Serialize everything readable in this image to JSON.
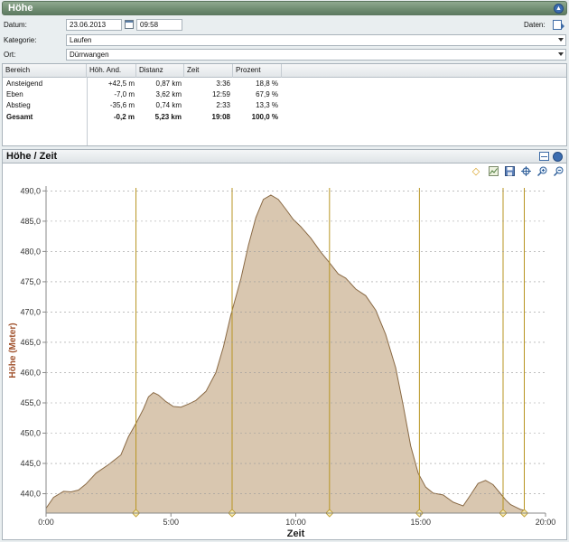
{
  "window": {
    "title": "Höhe"
  },
  "form": {
    "datum_label": "Datum:",
    "datum_value": "23.06.2013",
    "time_value": "09:58",
    "daten_label": "Daten:",
    "kategorie_label": "Kategorie:",
    "kategorie_value": "Laufen",
    "ort_label": "Ort:",
    "ort_value": "Dürrwangen"
  },
  "table": {
    "headers": [
      "Bereich",
      "Höh. And.",
      "Distanz",
      "Zeit",
      "Prozent"
    ],
    "rows": [
      {
        "bereich": "Ansteigend",
        "hoehe": "+42,5 m",
        "distanz": "0,87 km",
        "zeit": "3:36",
        "prozent": "18,8 %"
      },
      {
        "bereich": "Eben",
        "hoehe": "-7,0 m",
        "distanz": "3,62 km",
        "zeit": "12:59",
        "prozent": "67,9 %"
      },
      {
        "bereich": "Abstieg",
        "hoehe": "-35,6 m",
        "distanz": "0,74 km",
        "zeit": "2:33",
        "prozent": "13,3 %"
      },
      {
        "bereich": "Gesamt",
        "hoehe": "-0,2 m",
        "distanz": "5,23 km",
        "zeit": "19:08",
        "prozent": "100,0 %"
      }
    ]
  },
  "chart_panel": {
    "title": "Höhe / Zeit"
  },
  "toolbar_icons": [
    "diamond-marker-icon",
    "chart-settings-icon",
    "save-icon",
    "crosshair-icon",
    "zoom-in-icon",
    "zoom-out-icon"
  ],
  "colors": {
    "fill": "#d9c7b0",
    "stroke": "#8a6a45",
    "marker": "#b89522",
    "axis_label": "#a0522d"
  },
  "chart_data": {
    "type": "area",
    "title": "",
    "xlabel": "Zeit",
    "ylabel": "Höhe (Meter)",
    "xlim": [
      0,
      20
    ],
    "ylim": [
      436.8,
      490.5
    ],
    "x_ticks": [
      "0:00",
      "5:00",
      "10:00",
      "15:00",
      "20:00"
    ],
    "y_ticks": [
      "440,0",
      "445,0",
      "450,0",
      "455,0",
      "460,0",
      "465,0",
      "470,0",
      "475,0",
      "480,0",
      "485,0",
      "490,0"
    ],
    "x": [
      0.0,
      0.3,
      0.7,
      1.0,
      1.3,
      1.6,
      2.0,
      2.5,
      3.0,
      3.3,
      3.6,
      3.9,
      4.1,
      4.3,
      4.5,
      4.8,
      5.1,
      5.4,
      5.7,
      6.0,
      6.4,
      6.8,
      7.1,
      7.4,
      7.8,
      8.1,
      8.4,
      8.7,
      9.0,
      9.3,
      9.6,
      9.9,
      10.2,
      10.6,
      11.0,
      11.3,
      11.7,
      12.0,
      12.4,
      12.8,
      13.2,
      13.6,
      14.0,
      14.3,
      14.6,
      14.9,
      15.2,
      15.5,
      15.9,
      16.3,
      16.7,
      17.0,
      17.3,
      17.6,
      17.9,
      18.2,
      18.4,
      18.6,
      18.8,
      19.0,
      19.2
    ],
    "y": [
      437.6,
      439.4,
      440.4,
      440.3,
      440.6,
      441.6,
      443.4,
      444.8,
      446.4,
      449.4,
      451.6,
      454.0,
      456.0,
      456.7,
      456.3,
      455.2,
      454.4,
      454.3,
      454.8,
      455.4,
      456.9,
      460.0,
      464.2,
      469.5,
      475.5,
      481.0,
      485.6,
      488.6,
      489.3,
      488.6,
      487.0,
      485.3,
      484.1,
      482.2,
      479.9,
      478.4,
      476.3,
      475.6,
      473.8,
      472.7,
      470.3,
      466.3,
      460.8,
      454.6,
      447.9,
      443.4,
      441.1,
      440.1,
      439.8,
      438.6,
      438.0,
      439.8,
      441.7,
      442.2,
      441.5,
      440.0,
      439.0,
      438.2,
      437.8,
      437.4,
      437.2
    ],
    "markers_x": [
      3.6,
      7.45,
      11.35,
      14.95,
      18.3,
      19.15
    ],
    "grid": false,
    "legend": "none"
  }
}
